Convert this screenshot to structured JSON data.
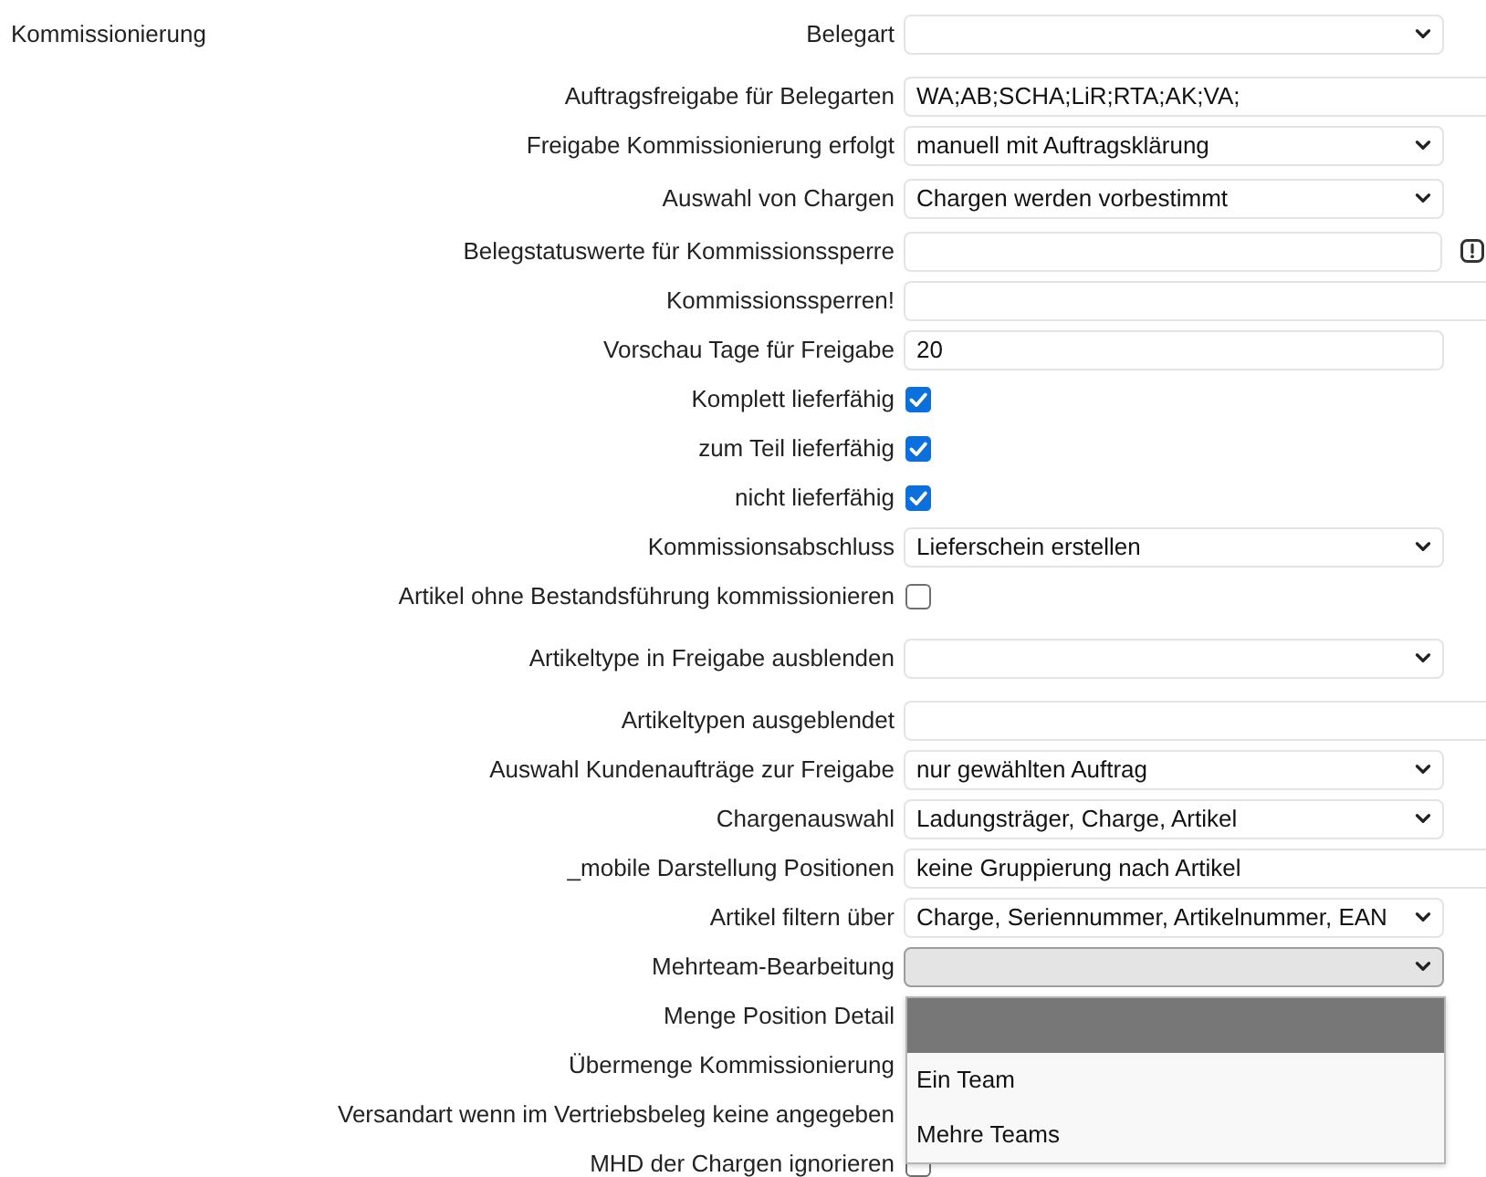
{
  "section": {
    "title": "Kommissionierung"
  },
  "fields": [
    {
      "label": "Belegart",
      "kind": "select",
      "expanded": false
    },
    {
      "label": "Auftragsfreigabe für Belegarten",
      "kind": "longinput",
      "value": "WA;AB;SCHA;LiR;RTA;AK;VA;"
    },
    {
      "label": "Freigabe Kommissionierung erfolgt",
      "kind": "select",
      "expanded": false,
      "value": "manuell mit Auftragsklärung"
    },
    {
      "label": "Auswahl von Chargen",
      "kind": "select",
      "expanded": false,
      "value": "Chargen werden vorbestimmt"
    },
    {
      "label": "Belegstatuswerte für Kommissionssperre",
      "kind": "infoinput"
    },
    {
      "label": "Kommissionssperren!",
      "kind": "longinput"
    },
    {
      "label": "Vorschau Tage für Freigabe",
      "kind": "input",
      "value": "20"
    },
    {
      "label": "Komplett lieferfähig",
      "kind": "checkbox",
      "checked": true
    },
    {
      "label": "zum Teil lieferfähig",
      "kind": "checkbox",
      "checked": true
    },
    {
      "label": "nicht lieferfähig",
      "kind": "checkbox",
      "checked": true
    },
    {
      "label": "Kommissionsabschluss",
      "kind": "select",
      "expanded": false,
      "value": "Lieferschein erstellen"
    },
    {
      "label": "Artikel ohne Bestandsführung kommissionieren",
      "kind": "checkbox",
      "checked": false
    },
    {
      "label": "Artikeltype in Freigabe ausblenden",
      "kind": "select",
      "expanded": false
    },
    {
      "label": "Artikeltypen ausgeblendet",
      "kind": "longinput"
    },
    {
      "label": "Auswahl Kundenaufträge zur Freigabe",
      "kind": "select",
      "expanded": false,
      "value": "nur gewählten Auftrag"
    },
    {
      "label": "Chargenauswahl",
      "kind": "select",
      "expanded": false,
      "value": "Ladungsträger, Charge, Artikel"
    },
    {
      "label": "_mobile Darstellung Positionen",
      "kind": "longinput",
      "value": "keine Gruppierung nach Artikel"
    },
    {
      "label": "Artikel filtern über",
      "kind": "select",
      "expanded": false,
      "value": "Charge, Seriennummer, Artikelnummer, EAN"
    },
    {
      "label": "Mehrteam-Bearbeitung",
      "kind": "select",
      "expanded": true,
      "options": [
        {
          "selected": true
        },
        {
          "label": "Ein Team",
          "selected": false
        },
        {
          "label": "Mehre Teams",
          "selected": false
        }
      ]
    },
    {
      "label": "Menge Position Detail"
    },
    {
      "label": "Übermenge Kommissionierung"
    },
    {
      "label": "Versandart wenn im Vertriebsbeleg keine angegeben"
    },
    {
      "label": "MHD der Chargen ignorieren",
      "kind": "checkbox",
      "checked": false
    }
  ]
}
